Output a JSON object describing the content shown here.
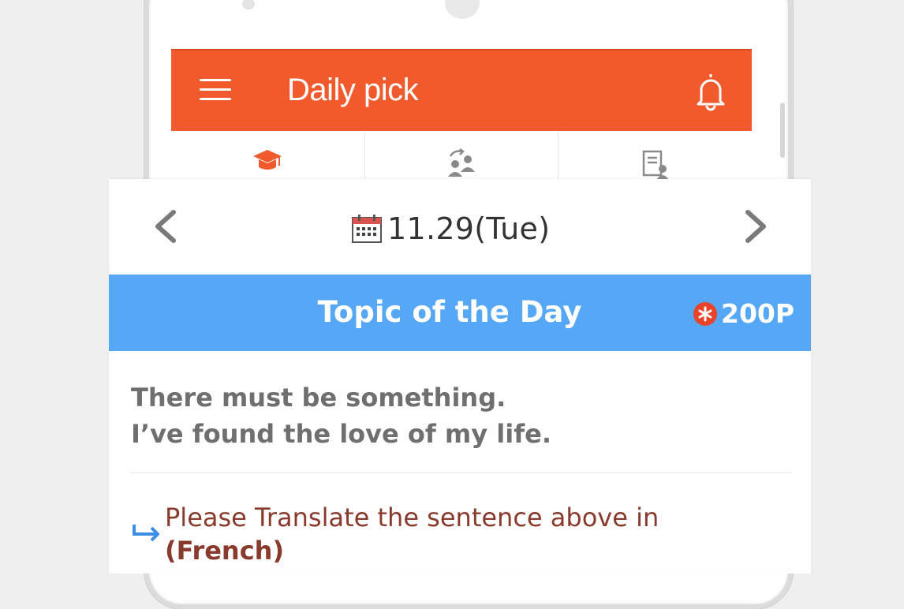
{
  "app": {
    "title": "Daily pick",
    "accent_color": "#f05a2c",
    "menu_icon": "hamburger-menu-icon",
    "notification_icon": "bell-icon"
  },
  "tabs": [
    {
      "icon": "graduation-cap-icon",
      "active": true
    },
    {
      "icon": "people-exchange-icon",
      "active": false
    },
    {
      "icon": "document-person-icon",
      "active": false
    }
  ],
  "date_nav": {
    "prev_icon": "chevron-left-icon",
    "next_icon": "chevron-right-icon",
    "calendar_icon": "calendar-icon",
    "date": "11.29(Tue)"
  },
  "topic": {
    "title": "Topic of the Day",
    "points": "200P",
    "points_icon": "point-star-icon",
    "bar_color": "#56a8f6"
  },
  "sentence": {
    "line1": "There must be something.",
    "line2": "I’ve found the love of my life."
  },
  "instruction": {
    "text": "Please Translate the sentence above in",
    "language": "(French)",
    "icon": "return-arrow-icon"
  }
}
